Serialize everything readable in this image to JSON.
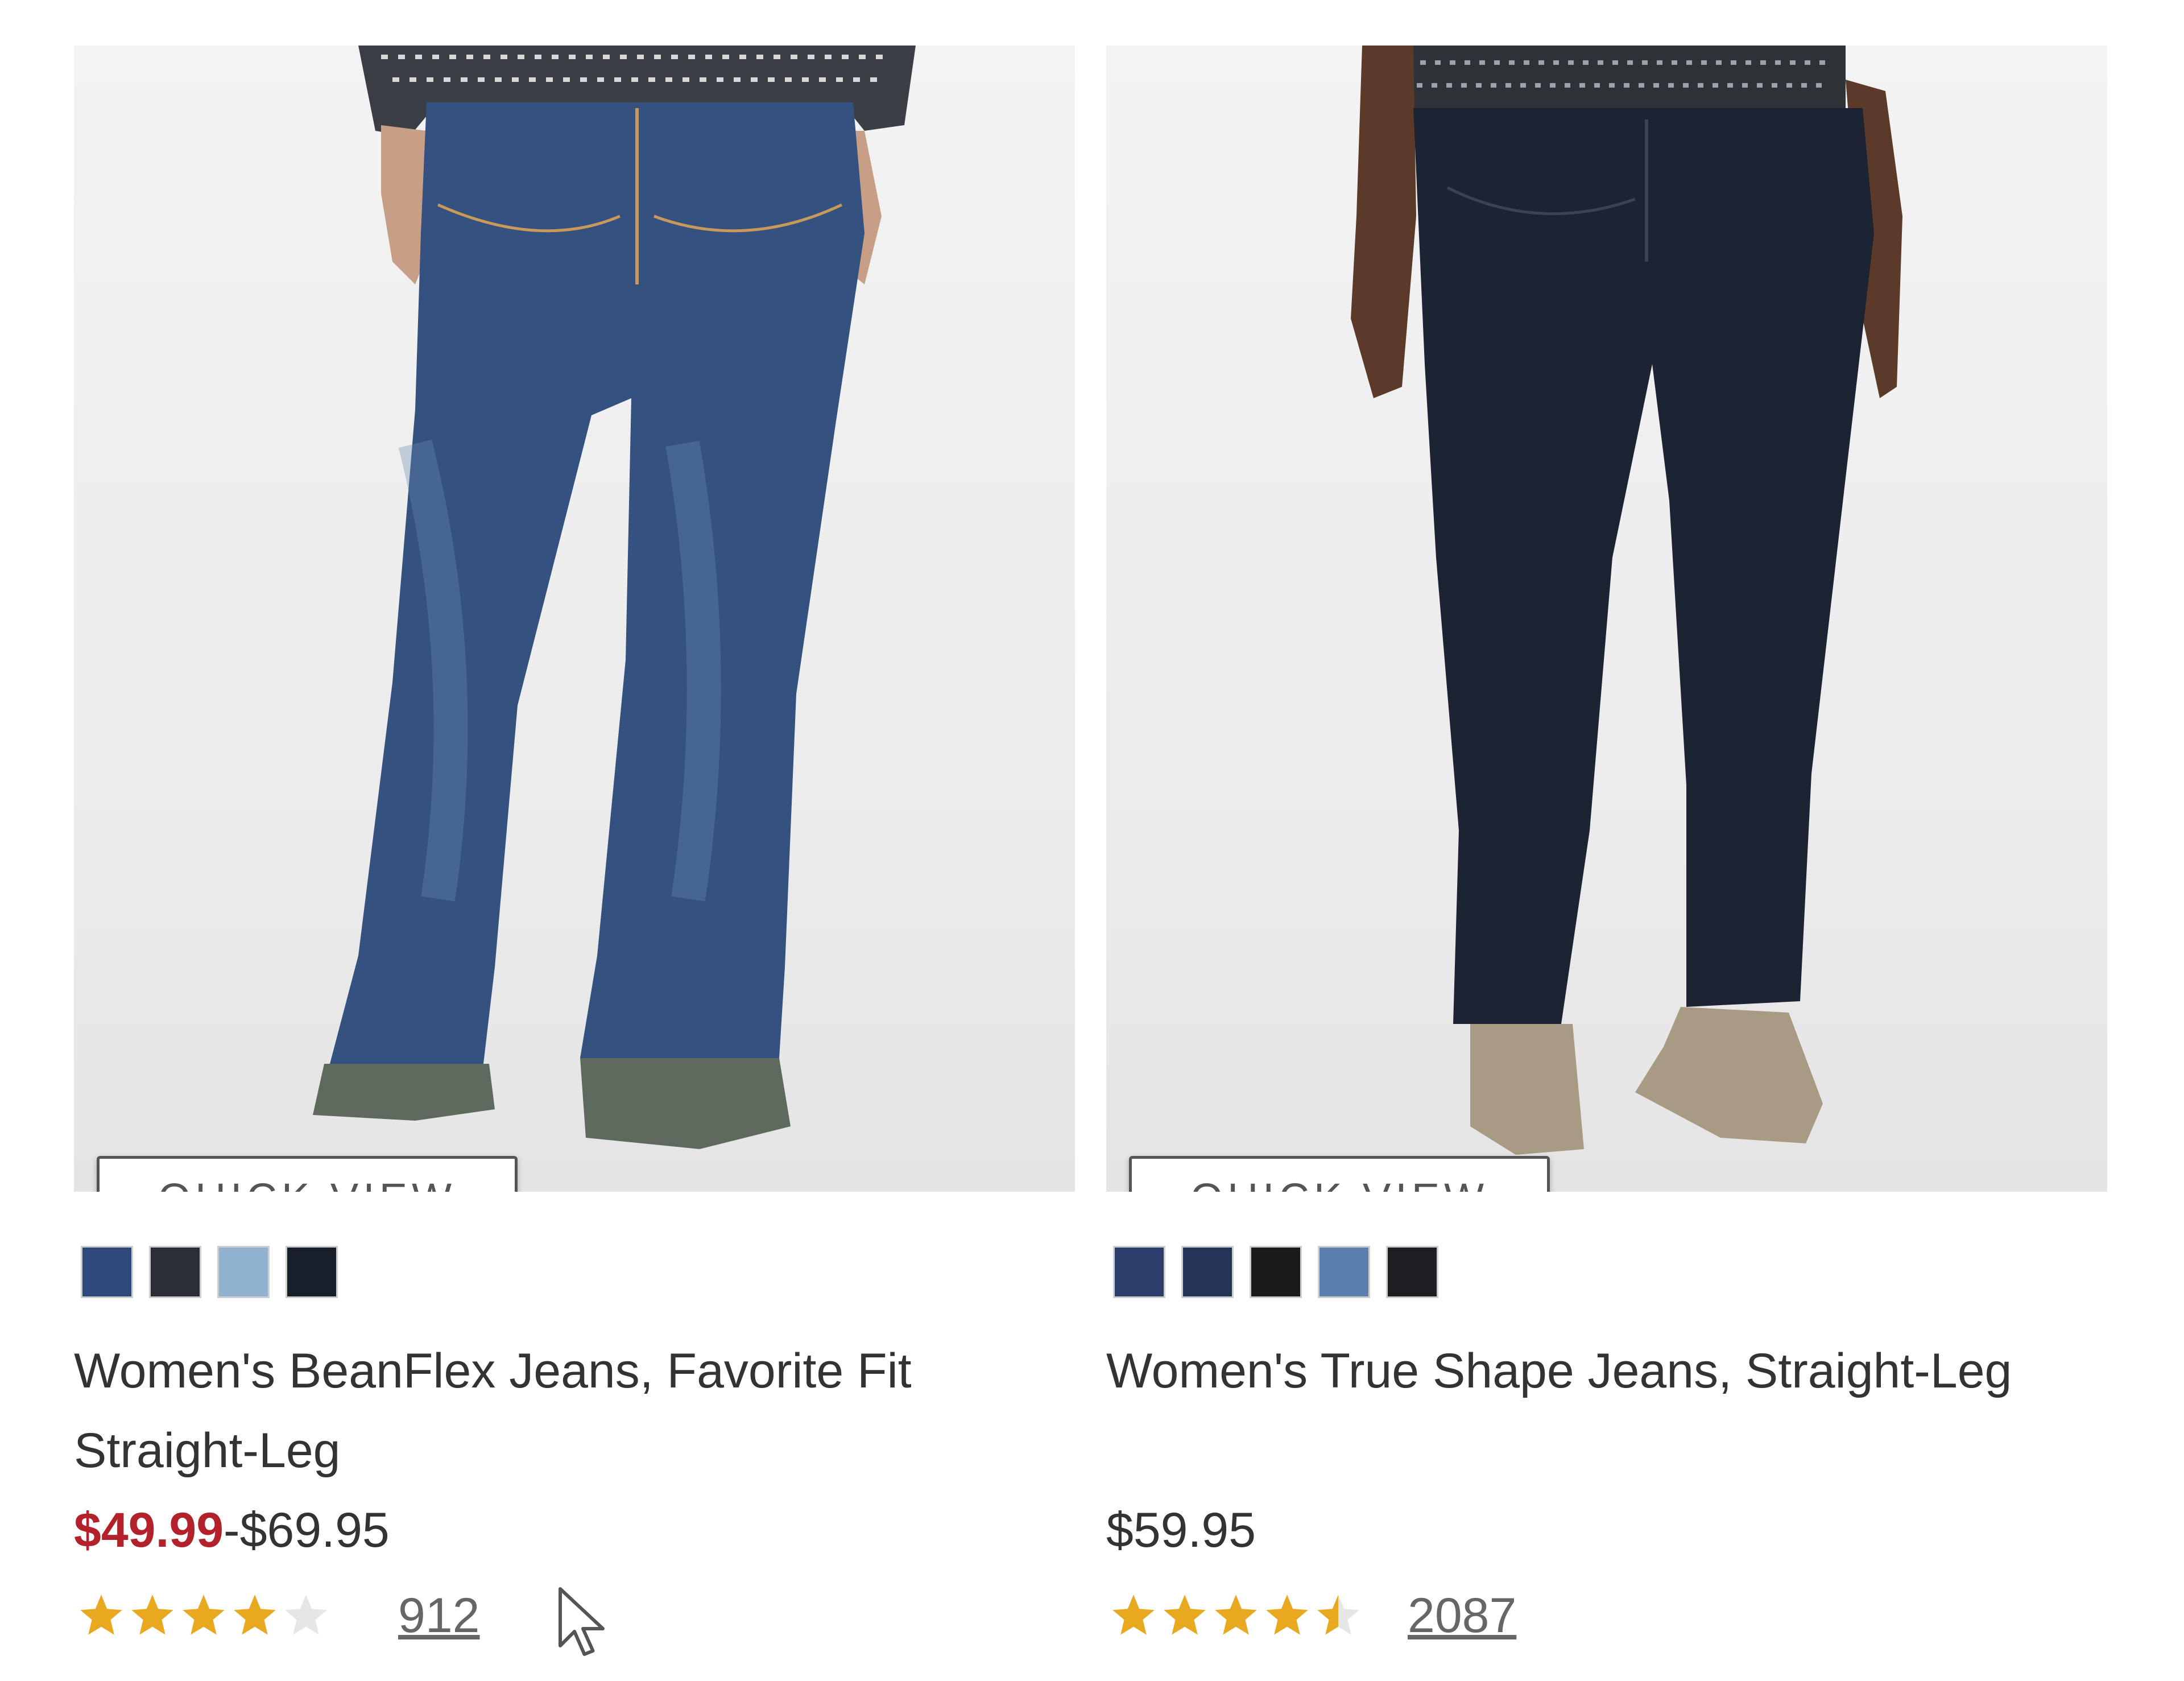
{
  "products": [
    {
      "quick_view_label": "QUICK VIEW",
      "swatches": [
        {
          "name": "medium-indigo",
          "color": "#2f4a7a"
        },
        {
          "name": "charcoal",
          "color": "#2c2f36"
        },
        {
          "name": "light-blue",
          "color": "#8fb0cf"
        },
        {
          "name": "rinse",
          "color": "#1a1f2c"
        }
      ],
      "title": "Women's BeanFlex Jeans, Favorite Fit Straight-Leg",
      "price_sale": "$49.99",
      "price_separator": "-",
      "price_regular": "$69.95",
      "rating": 4,
      "review_count": "912",
      "jeans_color": "#34517f"
    },
    {
      "quick_view_label": "QUICK VIEW",
      "swatches": [
        {
          "name": "indigo",
          "color": "#2c3f6c"
        },
        {
          "name": "navy",
          "color": "#243559"
        },
        {
          "name": "black",
          "color": "#1a1a1a"
        },
        {
          "name": "medium-wash",
          "color": "#5b7fae"
        },
        {
          "name": "dark-black",
          "color": "#1d1f22"
        }
      ],
      "title": "Women's True Shape Jeans, Straight-Leg",
      "price_regular": "$59.95",
      "rating": 4.5,
      "review_count": "2087",
      "jeans_color": "#1c2433"
    }
  ],
  "colors": {
    "star_filled": "#e8a920",
    "star_empty": "#e6e6e6",
    "sale_price": "#b3222a"
  }
}
